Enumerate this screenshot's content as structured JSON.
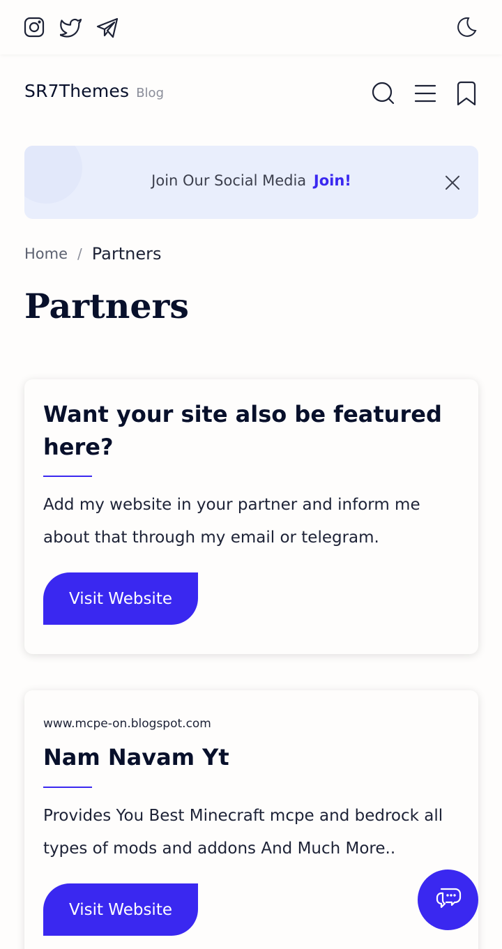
{
  "header": {
    "brand_name": "SR7Themes",
    "brand_tag": "Blog",
    "social_icons": [
      "instagram-icon",
      "twitter-icon",
      "telegram-icon"
    ],
    "theme_toggle_icon": "moon-icon",
    "action_icons": [
      "search-icon",
      "menu-icon",
      "bookmark-icon"
    ]
  },
  "banner": {
    "text": "Join Our Social Media",
    "link": "Join!",
    "close_icon": "close-icon"
  },
  "breadcrumb": {
    "home": "Home",
    "separator": "/",
    "current": "Partners"
  },
  "page_title": "Partners",
  "cards": [
    {
      "title": "Want your site also be featured here?",
      "description": "Add my website in your partner and inform me about that through my email or telegram.",
      "button": "Visit Website"
    },
    {
      "url": "www.mcpe-on.blogspot.com",
      "title": "Nam Navam Yt",
      "description": "Provides You Best Minecraft mcpe and bedrock all types of mods and addons And Much More..",
      "button": "Visit Website"
    }
  ],
  "chat_button_icon": "chat-icon",
  "colors": {
    "accent": "#3a28f0",
    "text_dark": "#08102b",
    "banner_bg": "#e9eefc",
    "page_bg": "#fefdfc"
  }
}
